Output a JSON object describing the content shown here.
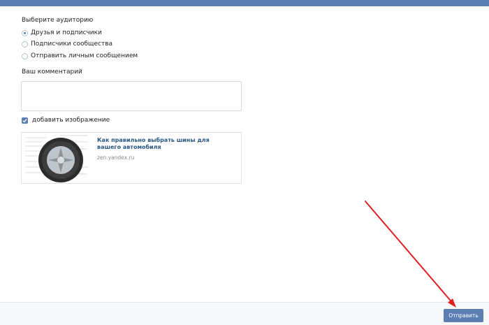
{
  "header": {
    "bar_color": "#5b7fb3"
  },
  "audience": {
    "title": "Выберите аудиторию",
    "options": [
      {
        "label": "Друзья и подписчики",
        "checked": true
      },
      {
        "label": "Подписчики сообщества",
        "checked": false
      },
      {
        "label": "Отправить личным сообщением",
        "checked": false
      }
    ]
  },
  "comment": {
    "label": "Ваш комментарий",
    "value": ""
  },
  "attach_image": {
    "label": "добавить изображение",
    "checked": true
  },
  "link_card": {
    "title": "Как правильно выбрать шины для вашего автомобиля",
    "domain": "zen.yandex.ru"
  },
  "footer": {
    "send_label": "Отправить"
  },
  "colors": {
    "accent": "#5b7fb3",
    "link": "#2a5885",
    "annotation_arrow": "#e02020"
  },
  "icons": {
    "checkbox": "checkmark-icon",
    "thumbnail": "tire-icon",
    "annotation": "red-arrow"
  }
}
